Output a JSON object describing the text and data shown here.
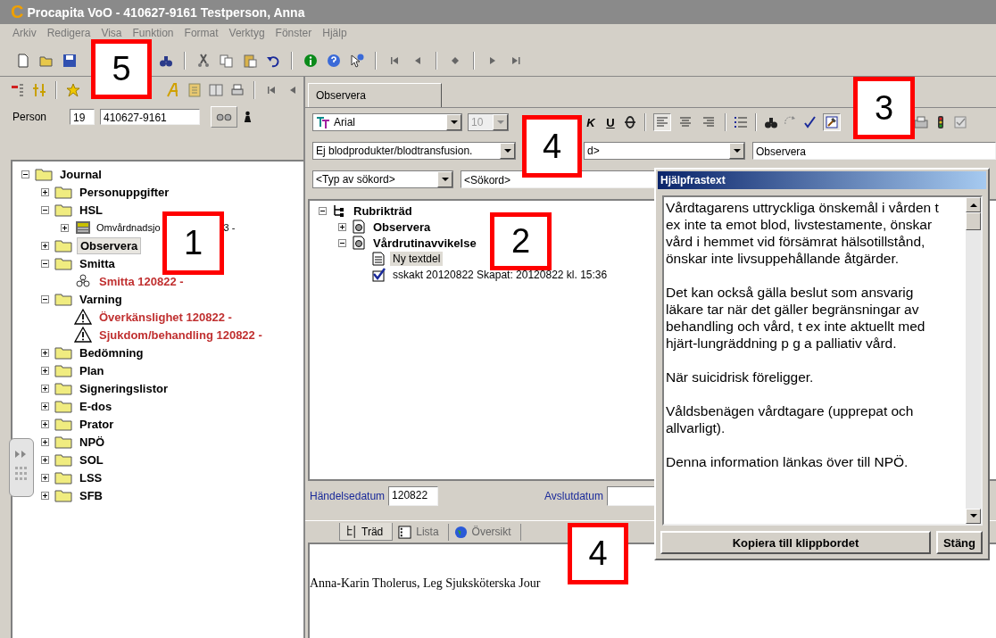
{
  "window": {
    "title": "Procapita VoO - 410627-9161 Testperson,  Anna",
    "logo": "C"
  },
  "menu": [
    "Arkiv",
    "Redigera",
    "Visa",
    "Funktion",
    "Format",
    "Verktyg",
    "Fönster",
    "Hjälp"
  ],
  "person": {
    "label": "Person",
    "century": "19",
    "id": "410627-9161"
  },
  "journal_tree": [
    {
      "label": "Journal",
      "kind": "folder",
      "expanded": true,
      "selected": false,
      "children": [
        {
          "label": "Personuppgifter",
          "kind": "folder",
          "expanded": false,
          "selected": false
        },
        {
          "label": "HSL",
          "kind": "folder",
          "expanded": true,
          "selected": false,
          "children": [
            {
              "label": "Omvårdnadsjo",
              "tail": "3 -",
              "kind": "record",
              "expanded": false,
              "selected": false
            }
          ]
        },
        {
          "label": "Observera",
          "kind": "folder",
          "expanded": false,
          "selected": true
        },
        {
          "label": "Smitta",
          "kind": "folder",
          "expanded": true,
          "selected": false,
          "children": [
            {
              "label": "Smitta 120822 -",
              "kind": "infection",
              "selected": false
            }
          ]
        },
        {
          "label": "Varning",
          "kind": "folder",
          "expanded": true,
          "selected": false,
          "children": [
            {
              "label": "Överkänslighet 120822 -",
              "kind": "warning",
              "selected": false
            },
            {
              "label": "Sjukdom/behandling 120822 -",
              "kind": "warning",
              "selected": false
            }
          ]
        },
        {
          "label": "Bedömning",
          "kind": "folder",
          "expanded": false,
          "selected": false
        },
        {
          "label": "Plan",
          "kind": "folder",
          "expanded": false,
          "selected": false
        },
        {
          "label": "Signeringslistor",
          "kind": "folder",
          "expanded": false,
          "selected": false
        },
        {
          "label": "E-dos",
          "kind": "folder",
          "expanded": false,
          "selected": false
        },
        {
          "label": "Prator",
          "kind": "folder",
          "expanded": false,
          "selected": false
        },
        {
          "label": "NPÖ",
          "kind": "folder",
          "expanded": false,
          "selected": false
        },
        {
          "label": "SOL",
          "kind": "folder",
          "expanded": false,
          "selected": false
        },
        {
          "label": "LSS",
          "kind": "folder",
          "expanded": false,
          "selected": false
        },
        {
          "label": "SFB",
          "kind": "folder",
          "expanded": false,
          "selected": false
        }
      ]
    }
  ],
  "editor_tabs": [
    {
      "label": "Observera",
      "selected": true
    }
  ],
  "format": {
    "font": "Arial",
    "size": "10",
    "size_disabled": true,
    "buttons": [
      {
        "label": "K",
        "kind": "italic"
      },
      {
        "label": "U",
        "kind": "underline"
      }
    ],
    "alignment": [
      {
        "selected": true
      },
      {
        "selected": false
      },
      {
        "selected": false
      }
    ]
  },
  "phrase_combo": "Ej blodprodukter/blodtransfusion.",
  "second_combo": "d>",
  "heading_field": "Observera",
  "search": {
    "type_combo": "<Typ av sökord>",
    "keyword": "<Sökord>"
  },
  "heading_tree": [
    {
      "label": "Rubrikträd",
      "kind": "root",
      "expanded": true,
      "selected": false,
      "children": [
        {
          "label": "Observera",
          "kind": "heading",
          "expanded": false,
          "selected": false
        },
        {
          "label": "Vårdrutinavvikelse",
          "kind": "heading",
          "expanded": true,
          "selected": false,
          "children": [
            {
              "label": "Ny textdel",
              "kind": "textpart",
              "selected": true
            },
            {
              "label": "sskakt 20120822 Skapat: 20120822 kl. 15:36",
              "kind": "signed",
              "selected": false
            }
          ]
        }
      ]
    }
  ],
  "dates": {
    "event_label": "Händelsedatum",
    "event_value": "120822",
    "end_label": "Avslutdatum"
  },
  "view_tabs": [
    {
      "label": "Träd",
      "kind": "tree",
      "selected": true
    },
    {
      "label": "Lista",
      "kind": "list",
      "selected": false
    },
    {
      "label": "Översikt",
      "kind": "overview",
      "selected": false
    }
  ],
  "note_text": "Anna-Karin Tholerus, Leg Sjuksköterska Jour",
  "help_dialog": {
    "title": "Hjälpfrastext",
    "paragraphs": [
      "Vårdtagarens uttryckliga önskemål i vården t ex inte ta emot blod, livstestamente, önskar vård i hemmet vid  försämrat hälsotillstånd, önskar inte livsuppehållande åtgärder.",
      "Det kan också gälla beslut som ansvarig läkare tar när det gäller begränsningar av behandling och vård, t ex inte aktuellt med hjärt-lungräddning p g a palliativ vård.",
      "När suicidrisk föreligger.",
      "Våldsbenägen vårdtagare (upprepat och allvarligt).",
      "Denna information länkas över till NPÖ."
    ],
    "buttons": [
      "Kopiera till klippbordet",
      "Stäng"
    ]
  },
  "callouts": [
    "5",
    "1",
    "2",
    "3",
    "4",
    "4"
  ]
}
